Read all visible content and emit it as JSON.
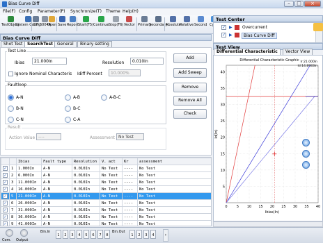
{
  "window": {
    "title": "Bias Curve Diff"
  },
  "menu": [
    "File(F)",
    "Config",
    "Parameter(P)",
    "Synchronize(T)",
    "Theme",
    "Help(H)"
  ],
  "toolbar": [
    {
      "label": "TestObject",
      "icon": "test-object-icon",
      "color": "#2e8b3e"
    },
    {
      "label": "System Config",
      "icon": "system-config-icon",
      "color": "#3a6fb6"
    },
    {
      "label": "Off",
      "icon": "off-icon",
      "color": "#6b7d96"
    },
    {
      "label": "60044",
      "icon": "60044-icon",
      "color": "#8a94a3"
    },
    {
      "label": "Open",
      "icon": "open-folder-icon",
      "color": "#e0a83a"
    },
    {
      "label": "Save",
      "icon": "save-icon",
      "color": "#3b66b0"
    },
    {
      "label": "Report",
      "icon": "report-icon",
      "color": "#4a7fc4"
    },
    {
      "label": "Start(F5)",
      "icon": "start-icon",
      "color": "#2aa64a"
    },
    {
      "label": "Continue",
      "icon": "continue-icon",
      "color": "#2aa64a"
    },
    {
      "label": "Stop(F6)",
      "icon": "stop-icon",
      "color": "#9aa3ad"
    },
    {
      "label": "Vector",
      "icon": "vector-icon",
      "color": "#c94b4b"
    },
    {
      "label": "Primary",
      "icon": "primary-icon",
      "color": "#6a7c95"
    },
    {
      "label": "Secondary",
      "icon": "secondary-icon",
      "color": "#5c6f8a"
    },
    {
      "label": "Absolute",
      "icon": "absolute-icon",
      "color": "#5270a8"
    },
    {
      "label": "Relative",
      "icon": "relative-icon",
      "color": "#5270a8"
    },
    {
      "label": "Second",
      "icon": "second-icon",
      "color": "#5a8ad0"
    },
    {
      "label": "Cycle",
      "icon": "cycle-icon",
      "color": "#4a8fd6"
    },
    {
      "label": "Bi",
      "icon": "bi-icon",
      "color": "#4d7bb8"
    }
  ],
  "left_panel": {
    "title": "Bias Curve Diff",
    "tabs": [
      "Shot Test",
      "SearchTest",
      "General",
      "Binary setting"
    ],
    "active_tab": "SearchTest",
    "test_line_label": "Test Line",
    "ibias_label": "Ibias",
    "ibias_value": "21.000In",
    "resolution_label": "Resolution",
    "resolution_value": "0.010In",
    "ignore_label": "Ignore Nominal Characteris",
    "idiff_label": "Idiff Percent",
    "idiff_value": "10.000%",
    "fault_loop_label": "Faultloop",
    "faults": [
      "A-N",
      "A-B",
      "A-B-C",
      "B-N",
      "B-C",
      "C-N",
      "C-A"
    ],
    "selected_fault": "A-N",
    "result_label": "Result",
    "action_value_label": "Action Value",
    "action_value": "----",
    "assessment_label": "Assessment",
    "assessment_value": "No Test",
    "buttons": {
      "add": "Add",
      "add_sweep": "Add Sweep",
      "remove": "Remove",
      "remove_all": "Remove All",
      "check": "Check"
    }
  },
  "table": {
    "headers": [
      "",
      "",
      "Ibias",
      "Fault type",
      "Resolution",
      "V. act",
      "Kr",
      "assessment"
    ],
    "rows": [
      {
        "n": "1",
        "ibias": "1.000In",
        "fault": "A-N",
        "res": "0.010In",
        "vact": "No Test",
        "kr": "----",
        "assess": "No Test"
      },
      {
        "n": "2",
        "ibias": "6.000In",
        "fault": "A-N",
        "res": "0.010In",
        "vact": "No Test",
        "kr": "----",
        "assess": "No Test"
      },
      {
        "n": "3",
        "ibias": "11.000In",
        "fault": "A-N",
        "res": "0.010In",
        "vact": "No Test",
        "kr": "----",
        "assess": "No Test"
      },
      {
        "n": "4",
        "ibias": "16.000In",
        "fault": "A-N",
        "res": "0.010In",
        "vact": "No Test",
        "kr": "----",
        "assess": "No Test"
      },
      {
        "n": "5",
        "ibias": "21.000In",
        "fault": "A-N",
        "res": "0.010In",
        "vact": "No Test",
        "kr": "----",
        "assess": "No Test"
      },
      {
        "n": "6",
        "ibias": "26.000In",
        "fault": "A-N",
        "res": "0.010In",
        "vact": "No Test",
        "kr": "----",
        "assess": "No Test"
      },
      {
        "n": "7",
        "ibias": "31.000In",
        "fault": "A-N",
        "res": "0.010In",
        "vact": "No Test",
        "kr": "----",
        "assess": "No Test"
      },
      {
        "n": "8",
        "ibias": "36.000In",
        "fault": "A-N",
        "res": "0.010In",
        "vact": "No Test",
        "kr": "----",
        "assess": "No Test"
      },
      {
        "n": "9",
        "ibias": "41.000In",
        "fault": "A-N",
        "res": "0.010In",
        "vact": "No Test",
        "kr": "----",
        "assess": "No Test"
      }
    ],
    "selected_row": 5
  },
  "test_center": {
    "title": "Test Center",
    "items": [
      "Overcurrent",
      "Bias Curve Diff"
    ],
    "selected": "Bias Curve Diff"
  },
  "test_view": {
    "title": "Test View",
    "tabs": [
      "Differential Characteristic",
      "Vector View"
    ],
    "active_tab": "Differential Characteristic"
  },
  "chart_data": {
    "type": "line",
    "title": "Differential Characteristic Graphic",
    "xlabel": "Ibias(In)",
    "ylabel": "Id(In)",
    "xlim": [
      0,
      40
    ],
    "ylim": [
      0,
      42
    ],
    "xticks": [
      0,
      5,
      10,
      15,
      20,
      25,
      30,
      35,
      40
    ],
    "yticks": [
      5,
      10,
      15,
      20,
      25,
      30,
      35,
      40
    ],
    "annotations": [
      "Ir:21.000In",
      "Id:14.8983In"
    ],
    "series": [
      {
        "color": "#e23b3b",
        "points": [
          [
            0,
            0
          ],
          [
            12.5,
            42
          ]
        ]
      },
      {
        "color": "#e23b3b",
        "points": [
          [
            0,
            32.5
          ],
          [
            40,
            32.5
          ]
        ]
      },
      {
        "color": "#3a3ad8",
        "points": [
          [
            0,
            0
          ],
          [
            36.5,
            42
          ]
        ]
      },
      {
        "color": "#7a7ae6",
        "points": [
          [
            0,
            0
          ],
          [
            38.5,
            32.5
          ]
        ]
      },
      {
        "color": "#2a2ab8",
        "points": [
          [
            34.5,
            32.5
          ],
          [
            40,
            32.5
          ]
        ]
      }
    ],
    "test_line": {
      "color": "#e06060",
      "x": 21
    },
    "test_point": {
      "x": 21,
      "y": 14.9,
      "color": "#e02020"
    }
  },
  "statusbar": {
    "items": [
      "Com.",
      "Output"
    ],
    "binin_label": "Bin.In",
    "binout_label": "Bin.Out",
    "binin": [
      "1",
      "2",
      "3",
      "4",
      "5",
      "6",
      "7",
      "8"
    ],
    "binout": [
      "1",
      "2",
      "3",
      "4"
    ]
  }
}
